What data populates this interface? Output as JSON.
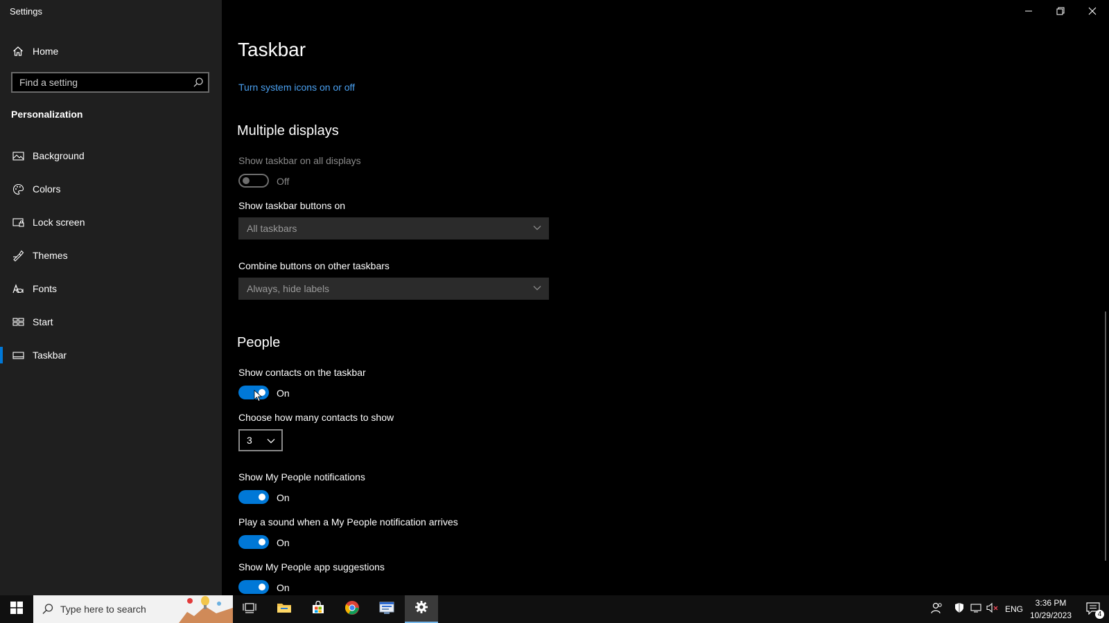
{
  "window": {
    "title": "Settings"
  },
  "sidebar": {
    "home_label": "Home",
    "search_placeholder": "Find a setting",
    "section_heading": "Personalization",
    "items": [
      {
        "label": "Background",
        "icon": "picture-icon"
      },
      {
        "label": "Colors",
        "icon": "palette-icon"
      },
      {
        "label": "Lock screen",
        "icon": "lock-screen-icon"
      },
      {
        "label": "Themes",
        "icon": "themes-icon"
      },
      {
        "label": "Fonts",
        "icon": "fonts-icon"
      },
      {
        "label": "Start",
        "icon": "start-icon"
      },
      {
        "label": "Taskbar",
        "icon": "taskbar-icon",
        "selected": true
      }
    ]
  },
  "main": {
    "title": "Taskbar",
    "system_icons_link": "Turn system icons on or off",
    "multiple_displays": {
      "heading": "Multiple displays",
      "show_on_all_label": "Show taskbar on all displays",
      "show_on_all_state": "Off",
      "buttons_on_label": "Show taskbar buttons on",
      "buttons_on_value": "All taskbars",
      "combine_label": "Combine buttons on other taskbars",
      "combine_value": "Always, hide labels"
    },
    "people": {
      "heading": "People",
      "show_contacts_label": "Show contacts on the taskbar",
      "show_contacts_state": "On",
      "how_many_label": "Choose how many contacts to show",
      "how_many_value": "3",
      "notifications_label": "Show My People notifications",
      "notifications_state": "On",
      "sound_label": "Play a sound when a My People notification arrives",
      "sound_state": "On",
      "suggestions_label": "Show My People app suggestions",
      "suggestions_state": "On"
    }
  },
  "taskbar": {
    "search_placeholder": "Type here to search",
    "language": "ENG",
    "time": "3:36 PM",
    "date": "10/29/2023",
    "notification_count": "4"
  },
  "colors": {
    "accent": "#0078d7",
    "link": "#4aa0f0",
    "sidebar_bg": "#1f1f1f"
  }
}
